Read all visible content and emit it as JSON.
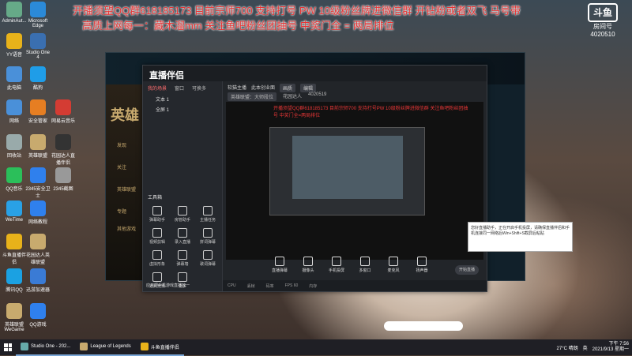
{
  "overlay": {
    "line1": "开播须望QQ群618185173   目前宗师700   支持打号 PW   10级粉丝牌进微信群   开钻粉或者双飞 马号带",
    "line2": "高质上网每一：藏木溜mm     关注鱼吧粉丝团抽号     中奖门全 = 两局排位"
  },
  "badge": {
    "logo": "斗鱼",
    "label": "房间号",
    "room": "4020510"
  },
  "desktop_icons": [
    {
      "label": "AdminAut...",
      "color": "#6a8"
    },
    {
      "label": "Microsoft Edge",
      "color": "#2b8ad8"
    },
    {
      "label": "YY语音",
      "color": "#e8b21a"
    },
    {
      "label": "Studio One 4",
      "color": "#3a6fb0"
    },
    {
      "label": "此电脑",
      "color": "#4a90d9"
    },
    {
      "label": "酷狗",
      "color": "#1f9de8"
    },
    {
      "label": "网络",
      "color": "#4a90d9"
    },
    {
      "label": "安全管家",
      "color": "#e67e22"
    },
    {
      "label": "网易云音乐",
      "color": "#d43c33"
    },
    {
      "label": "回收站",
      "color": "#9aa"
    },
    {
      "label": "英雄联盟",
      "color": "#c8aa6e"
    },
    {
      "label": "花园达人直播伴侣",
      "color": "#333"
    },
    {
      "label": "QQ音乐",
      "color": "#2bbf5a"
    },
    {
      "label": "2345安全卫士",
      "color": "#2f80ed"
    },
    {
      "label": "2345截图",
      "color": "#999"
    },
    {
      "label": "WeTime",
      "color": "#29a1e6"
    },
    {
      "label": "网络教程",
      "color": "#2f80ed"
    },
    {
      "label": "斗鱼直播伴侣",
      "color": "#e8b21a"
    },
    {
      "label": "花园达人英雄联盟",
      "color": "#c8aa6e"
    },
    {
      "label": "腾讯QQ",
      "color": "#1ba1e2"
    },
    {
      "label": "迅游加速器",
      "color": "#3a7bd5"
    },
    {
      "label": "英雄联盟WeGame",
      "color": "#c8aa6e"
    },
    {
      "label": "QQ游戏",
      "color": "#2f80ed"
    }
  ],
  "lol": {
    "title": "英雄",
    "items": [
      "发现",
      "关注",
      "英雄联盟",
      "专题",
      "其他游戏"
    ]
  },
  "app": {
    "brand": "直播伴侣",
    "tabs": [
      "我的场景",
      "窗口",
      "可换多"
    ],
    "scenes": [
      "文本 1",
      "全屏 1"
    ],
    "tools_title": "工具箱",
    "tools": [
      "弹幕助手",
      "房管助手",
      "主播任务",
      "视频剪辑",
      "录入直播",
      "拼词弹幕",
      "虚拟形象",
      "弹幕墙",
      "歌词弹幕",
      "道具竞猜",
      "更多"
    ],
    "hint": "应用把手机游戏直播放一",
    "topbar": [
      "软猫主播",
      "此本创业面",
      "画质",
      "编辑"
    ],
    "room": [
      "英雄联盟：大师段位",
      "花园达人",
      "4020519"
    ],
    "preview_text": "开播须望QQ群618185173 目前宗师700 支持打号PW 10级粉丝牌进微信群 关注鱼吧粉丝团抽号 中奖门全=两局排位",
    "bottom_tools": [
      "直播弹幕",
      "摄像头",
      "手机投屏",
      "多窗口",
      "麦克风",
      "扬声器"
    ],
    "go_live": "开始直播",
    "status": [
      "CPU",
      "丢帧",
      "码率",
      "FPS 60",
      "内存"
    ]
  },
  "popup": {
    "text": "您好直播助手，正在开启手机投屏，请确保直播伴侣和手机连接同一网络后Win+Shift+S截屏后粘贴"
  },
  "taskbar": {
    "items": [
      "Studio One - 202...",
      "League of Legends",
      "斗鱼直播伴侣"
    ],
    "weather": "27°C 晴朗",
    "ime": "英",
    "time": "下午 7:56",
    "date": "2021/9/13 星期一"
  }
}
